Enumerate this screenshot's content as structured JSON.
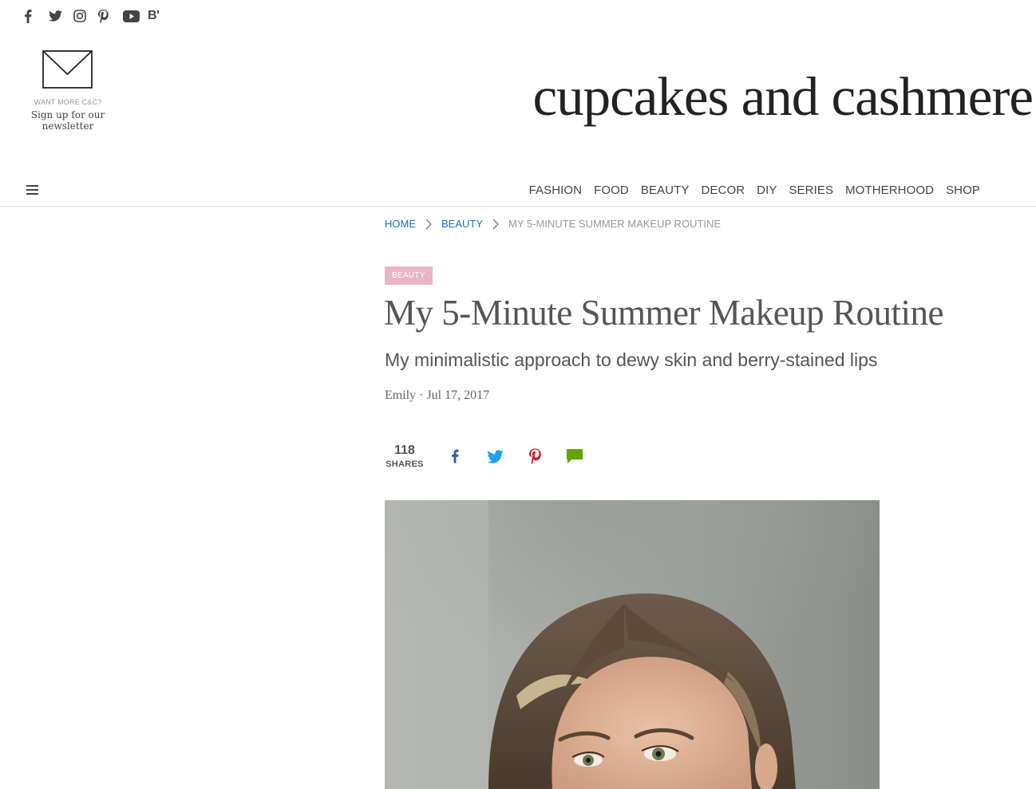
{
  "social": {
    "icons": [
      "facebook-icon",
      "twitter-icon",
      "instagram-icon",
      "pinterest-icon",
      "youtube-icon",
      "bloglovin-icon"
    ],
    "bloglovin_text": "B'"
  },
  "newsletter": {
    "small_label": "WANT MORE C&C?",
    "cta": "Sign up for our newsletter"
  },
  "logo": "cupcakes and cashmere",
  "nav": {
    "items": [
      "FASHION",
      "FOOD",
      "BEAUTY",
      "DECOR",
      "DIY",
      "SERIES",
      "MOTHERHOOD",
      "SHOP"
    ]
  },
  "breadcrumb": {
    "home": "HOME",
    "section": "BEAUTY",
    "current": "MY 5-MINUTE SUMMER MAKEUP ROUTINE"
  },
  "article": {
    "category": "BEAUTY",
    "title": "My 5-Minute Summer Makeup Routine",
    "subtitle": "My minimalistic approach to dewy skin and berry-stained lips",
    "byline": "Emily · Jul 17, 2017",
    "share_count": "118",
    "share_label": "SHARES"
  },
  "colors": {
    "link_blue": "#1a6fc4",
    "category_pink": "#e9b4c8",
    "facebook": "#3b5998",
    "twitter": "#1da1f2",
    "pinterest": "#cb2027",
    "comment": "#5fa500"
  }
}
